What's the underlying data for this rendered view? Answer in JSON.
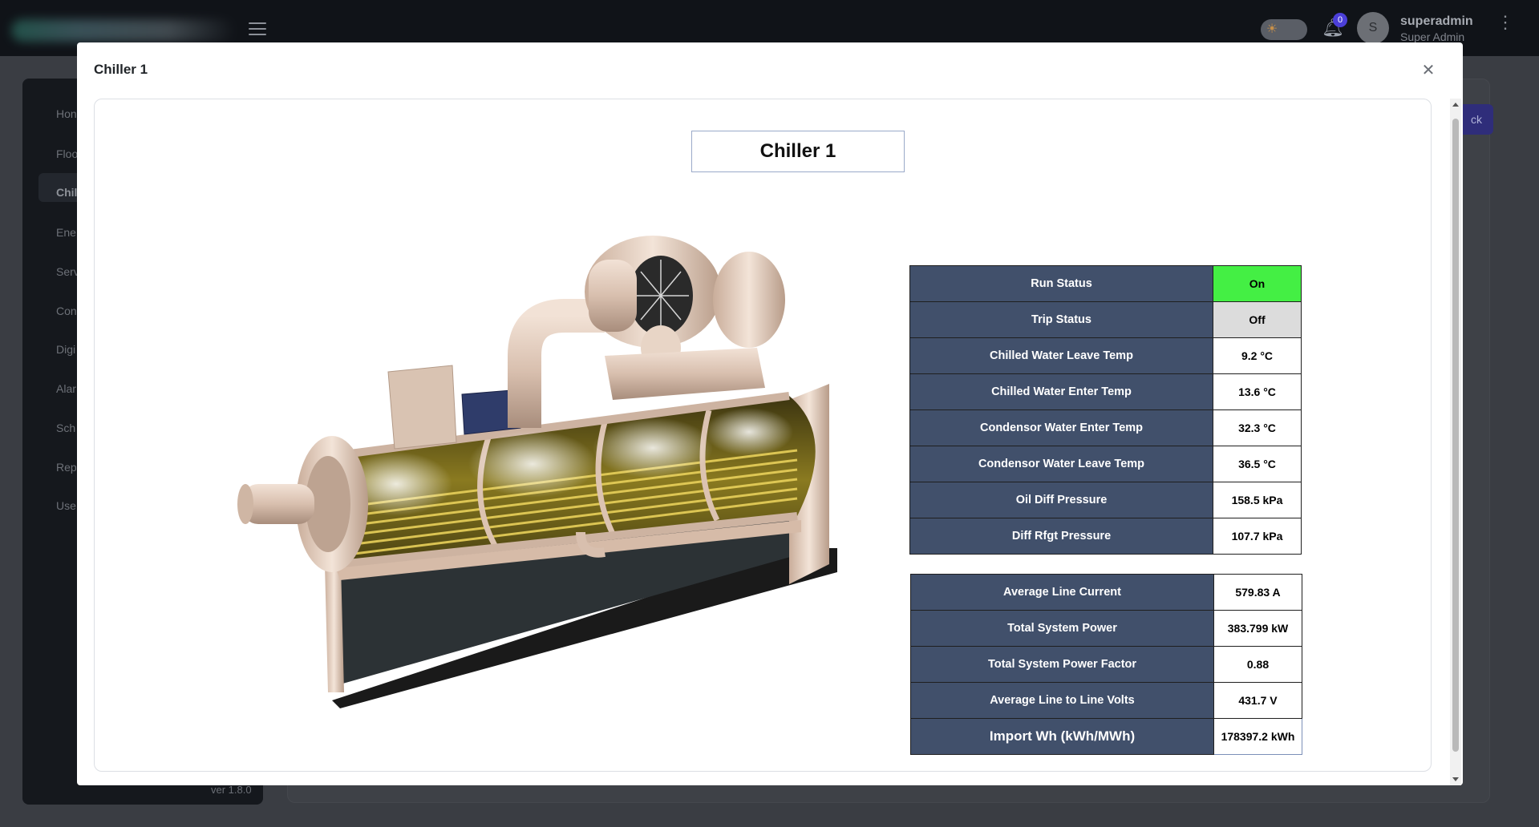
{
  "header": {
    "notifications_count": "0",
    "avatar_initial": "S",
    "user_name": "superadmin",
    "user_role": "Super Admin"
  },
  "sidebar": {
    "items": [
      "Hon",
      "Floo",
      "Chil",
      "Ene",
      "Serv",
      "Con",
      "Digi",
      "Alar",
      "Sch",
      "Rep",
      "Use"
    ],
    "version": "ver 1.8.0"
  },
  "main": {
    "back_label": "ck"
  },
  "modal": {
    "title": "Chiller 1",
    "close_icon": "close-icon",
    "panel_title": "Chiller 1",
    "status_table": [
      {
        "label": "Run Status",
        "value": "On"
      },
      {
        "label": "Trip Status",
        "value": "Off"
      },
      {
        "label": "Chilled Water Leave Temp",
        "value": "9.2 °C"
      },
      {
        "label": "Chilled Water Enter Temp",
        "value": "13.6 °C"
      },
      {
        "label": "Condensor Water Enter Temp",
        "value": "32.3 °C"
      },
      {
        "label": "Condensor Water Leave Temp",
        "value": "36.5 °C"
      },
      {
        "label": "Oil Diff Pressure",
        "value": "158.5 kPa"
      },
      {
        "label": "Diff Rfgt Pressure",
        "value": "107.7 kPa"
      }
    ],
    "power_table": [
      {
        "label": "Average Line Current",
        "value": "579.83 A"
      },
      {
        "label": "Total System Power",
        "value": "383.799 kW"
      },
      {
        "label": "Total System Power Factor",
        "value": "0.88"
      },
      {
        "label": "Average Line to Line Volts",
        "value": "431.7 V"
      },
      {
        "label": "Import Wh (kWh/MWh)",
        "value": "178397.2 kWh"
      }
    ]
  },
  "colors": {
    "run_on": "#44ef44",
    "trip_off": "#dcdcdc",
    "label_bg": "#41506b"
  }
}
